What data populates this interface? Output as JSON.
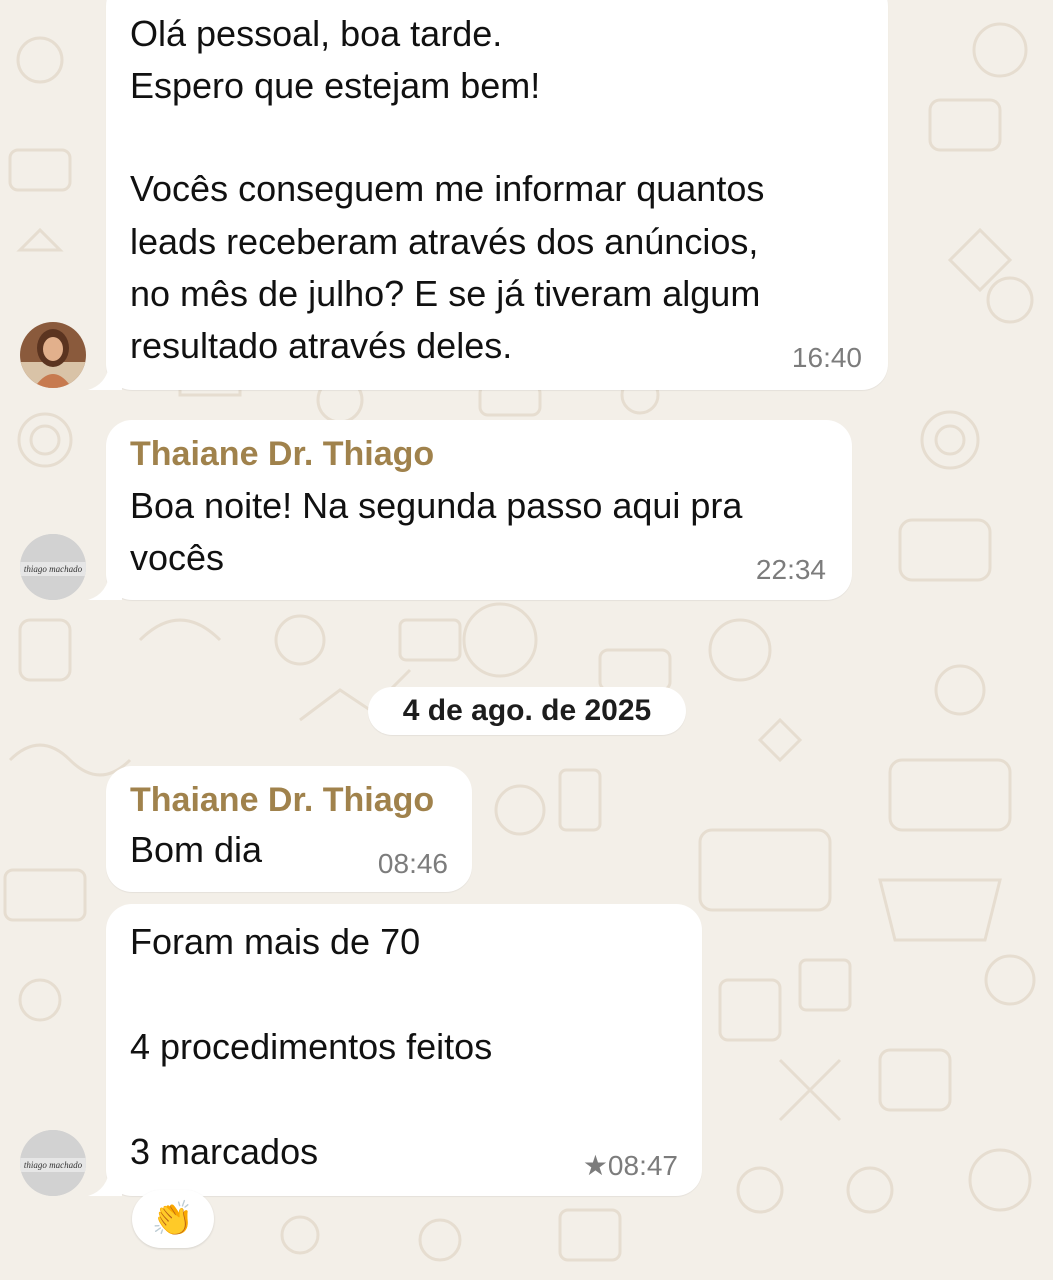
{
  "messages": [
    {
      "time": "16:40",
      "text_lines": [
        "Olá pessoal, boa tarde.",
        "Espero que estejam bem!",
        "",
        "Vocês conseguem me informar quantos",
        "leads receberam através dos anúncios,",
        "no mês de julho? E se já tiveram algum",
        "resultado através deles."
      ]
    },
    {
      "sender": "Thaiane Dr. Thiago",
      "time": "22:34",
      "text_lines": [
        "Boa noite! Na segunda passo aqui pra",
        "vocês"
      ]
    },
    {
      "sender": "Thaiane Dr. Thiago",
      "time": "08:46",
      "text_lines": [
        "Bom dia"
      ]
    },
    {
      "time": "★08:47",
      "text_lines": [
        "Foram mais de 70",
        "",
        "4 procedimentos feitos",
        "",
        "3 marcados"
      ],
      "reaction": "👏"
    }
  ],
  "date_separator": "4 de ago. de 2025",
  "avatar_logo_text": "thiago machado",
  "colors": {
    "background": "#f3efe8",
    "bubble": "#ffffff",
    "sender_name": "#a0824c",
    "timestamp": "#7c7c7c"
  }
}
